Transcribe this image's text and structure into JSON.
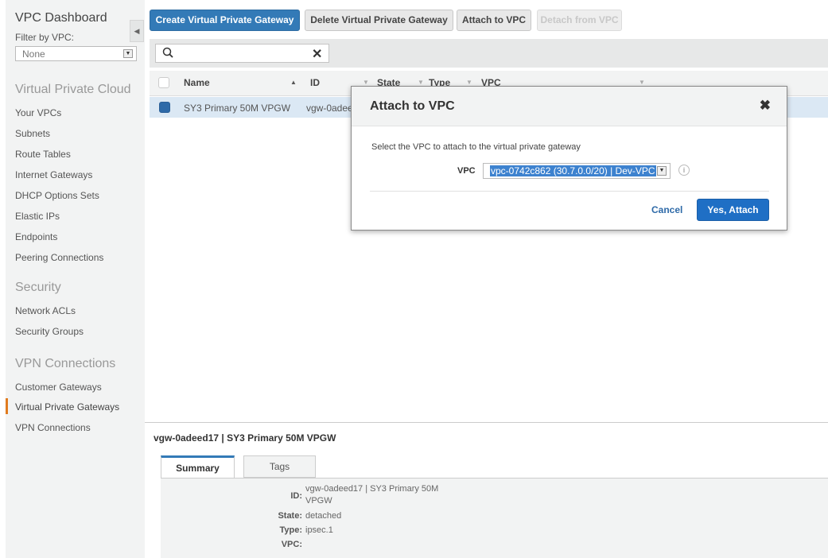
{
  "sidebar": {
    "title": "VPC Dashboard",
    "filter_label": "Filter by VPC:",
    "filter_value": "None",
    "sections": {
      "vpc": "Virtual Private Cloud",
      "security": "Security",
      "vpn": "VPN Connections"
    },
    "items": [
      "Your VPCs",
      "Subnets",
      "Route Tables",
      "Internet Gateways",
      "DHCP Options Sets",
      "Elastic IPs",
      "Endpoints",
      "Peering Connections",
      "Network ACLs",
      "Security Groups",
      "Customer Gateways",
      "Virtual Private Gateways",
      "VPN Connections"
    ],
    "accent_color": "#e07b1f"
  },
  "toolbar": {
    "create": "Create Virtual Private Gateway",
    "delete": "Delete Virtual Private Gateway",
    "attach": "Attach to VPC",
    "detach": "Detach from VPC"
  },
  "search": {
    "icon": "search-icon",
    "clear": "✕"
  },
  "table": {
    "columns": [
      "Name",
      "ID",
      "State",
      "Type",
      "VPC"
    ],
    "rows": [
      {
        "name": "SY3 Primary 50M VPGW",
        "id": "vgw-0adeed17",
        "selected": true
      }
    ]
  },
  "detail": {
    "title": "vgw-0adeed17 | SY3 Primary 50M VPGW",
    "tabs": [
      "Summary",
      "Tags"
    ],
    "fields": {
      "id_label": "ID:",
      "id_value_1": "vgw-0adeed17 | SY3 Primary 50M",
      "id_value_2": "VPGW",
      "state_label": "State:",
      "state_value": "detached",
      "type_label": "Type:",
      "type_value": "ipsec.1",
      "vpc_label": "VPC:"
    }
  },
  "modal": {
    "title": "Attach to VPC",
    "close": "✖",
    "description": "Select the VPC to attach to the virtual private gateway",
    "vpc_label": "VPC",
    "vpc_value": "vpc-0742c862 (30.7.0.0/20) | Dev-VPC",
    "cancel": "Cancel",
    "confirm": "Yes, Attach"
  },
  "colors": {
    "primary": "#337ab7",
    "confirm": "#1f6fc5",
    "selection": "#dbe8f4"
  }
}
